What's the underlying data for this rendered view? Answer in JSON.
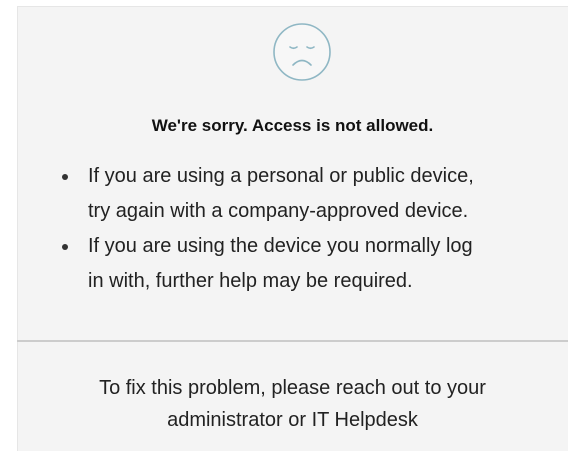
{
  "message": {
    "icon": "sad-face-icon",
    "heading": "We're sorry. Access is not allowed.",
    "bullets": [
      {
        "line1": "If you are using a personal or public device,",
        "line2": "try again with a company-approved device."
      },
      {
        "line1": "If you are using the device you normally log",
        "line2": "in with, further help may be required."
      }
    ]
  },
  "footer": {
    "line1": "To fix this problem, please reach out to your",
    "line2": "administrator or IT Helpdesk"
  },
  "colors": {
    "panel_background": "#f4f4f4",
    "divider": "#cccccc",
    "icon_stroke": "#8fb7c4",
    "text": "#222222"
  }
}
